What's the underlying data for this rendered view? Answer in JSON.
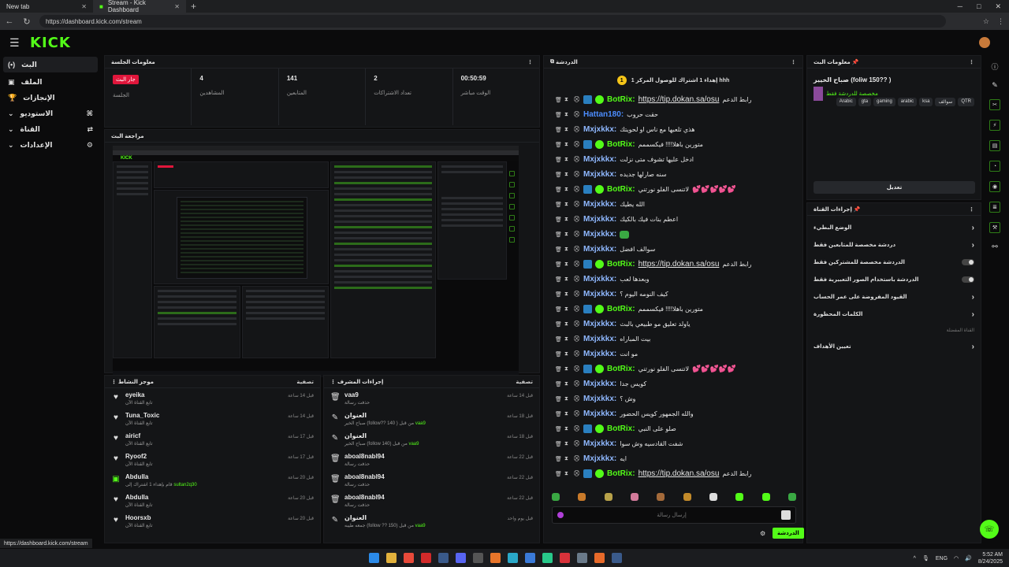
{
  "browser": {
    "tabs": [
      {
        "label": "New tab"
      },
      {
        "label": "Stream - Kick Dashboard"
      }
    ],
    "url": "https://dashboard.kick.com/stream",
    "status_url": "https://dashboard.kick.com/stream"
  },
  "app": {
    "logo": "KICK"
  },
  "leftnav": {
    "items": [
      {
        "label": "البث",
        "icon": "live-icon"
      },
      {
        "label": "الملف",
        "icon": "profile-icon"
      },
      {
        "label": "الإنجازات",
        "icon": "trophy-icon"
      },
      {
        "label": "الاستوديو",
        "icon": "studio-icon"
      },
      {
        "label": "القناة",
        "icon": "channel-icon"
      },
      {
        "label": "الإعدادات",
        "icon": "settings-icon"
      }
    ]
  },
  "session": {
    "title": "معلومات الجلسة",
    "stats": [
      {
        "value": "جار البث",
        "label": "الجلسة"
      },
      {
        "value": "4",
        "label": "المشاهدين"
      },
      {
        "value": "141",
        "label": "المتابعين"
      },
      {
        "value": "2",
        "label": "تعداد الاشتراكات"
      },
      {
        "value": "00:50:59",
        "label": "الوقت مباشر"
      }
    ]
  },
  "preview": {
    "title": "مراجعة البث",
    "logo": "KICK"
  },
  "activity": {
    "title": "موجز النشاط",
    "filter": "تصفية",
    "rows": [
      {
        "name": "eyeika",
        "sub": "تابع القناة الآن",
        "time": "قبل 14 ساعة",
        "icon": "heart-icon"
      },
      {
        "name": "Tuna_Toxic",
        "sub": "تابع القناة الآن",
        "time": "قبل 14 ساعة",
        "icon": "heart-icon"
      },
      {
        "name": "airicf",
        "sub": "تابع القناة الآن",
        "time": "قبل 17 ساعة",
        "icon": "heart-icon"
      },
      {
        "name": "Ryoof2",
        "sub": "تابع القناة الآن",
        "time": "قبل 17 ساعة",
        "icon": "heart-icon"
      },
      {
        "name": "Abdulla",
        "sub": "قام بإهداء 1 اشتراك إلى",
        "extra": "sultan2q30",
        "time": "قبل 20 ساعة",
        "icon": "gift-icon"
      },
      {
        "name": "Abdulla",
        "sub": "تابع القناة الآن",
        "time": "قبل 20 ساعة",
        "icon": "heart-icon"
      },
      {
        "name": "Hoorsxb",
        "sub": "تابع القناة الآن",
        "time": "قبل 20 ساعة",
        "icon": "heart-icon"
      }
    ]
  },
  "modactions": {
    "title": "إجراءات المشرف",
    "filter": "تصفية",
    "rows": [
      {
        "name": "vaa9",
        "sub": "حذفت رسالة",
        "time": "قبل 14 ساعة",
        "icon": "trash-icon"
      },
      {
        "name": "العنوان",
        "sub": "صباح الخير (follow?? 140 ) من قبل ",
        "user": "vaa9",
        "time": "قبل 18 ساعة",
        "icon": "edit-icon"
      },
      {
        "name": "العنوان",
        "sub": "صباح الخير (follow 140) من قبل ",
        "user": "vaa9",
        "time": "قبل 18 ساعة",
        "icon": "edit-icon"
      },
      {
        "name": "aboal8nabl94",
        "sub": "حذفت رسالة",
        "time": "قبل 22 ساعة",
        "icon": "trash-icon"
      },
      {
        "name": "aboal8nabl94",
        "sub": "حذفت رسالة",
        "time": "قبل 22 ساعة",
        "icon": "trash-icon"
      },
      {
        "name": "aboal8nabl94",
        "sub": "حذفت رسالة",
        "time": "قبل 22 ساعة",
        "icon": "trash-icon"
      },
      {
        "name": "العنوان",
        "sub": "جمعه طيبه (follow ?? 150) من قبل ",
        "user": "vaa9",
        "time": "قبل يوم واحد",
        "icon": "edit-icon"
      }
    ]
  },
  "chat": {
    "title": "الدردشة",
    "pinned_num": "1",
    "pinned": "إهداء 1 اشتراك للوصول المركز 1 hhh",
    "lines": [
      {
        "user": "BotRix",
        "bot": true,
        "text": "رابط الدعم",
        "link": "https://tip.dokan.sa/osu"
      },
      {
        "user": "Hattan180",
        "color": "#4c8dff",
        "text": "حقت حروب"
      },
      {
        "user": "Mxjxkkx",
        "text": "هذي تلعبها مع ناس او لحويتك"
      },
      {
        "user": "BotRix",
        "bot": true,
        "text": "متورين باهلا!!!! فيكسممم"
      },
      {
        "user": "Mxjxkkx",
        "text": "ادخل عليها تشوف متى نزلت"
      },
      {
        "user": "Mxjxkkx",
        "text": "سنه صارلها جديده"
      },
      {
        "user": "BotRix",
        "bot": true,
        "text": "لاتنسى الفلو نورتني",
        "hearts": "💕💕💕💕💕"
      },
      {
        "user": "Mxjxkkx",
        "text": "الله يطيك"
      },
      {
        "user": "Mxjxkkx",
        "text": "اعطم بنات فيك بالكيك"
      },
      {
        "user": "Mxjxkkx",
        "emote": true
      },
      {
        "user": "Mxjxkkx",
        "text": "سوالف افضل"
      },
      {
        "user": "BotRix",
        "bot": true,
        "text": "رابط الدعم",
        "link": "https://tip.dokan.sa/osu"
      },
      {
        "user": "Mxjxkkx",
        "text": "وبعدها لعب"
      },
      {
        "user": "Mxjxkkx",
        "text": "كيف النومه اليوم ؟"
      },
      {
        "user": "BotRix",
        "bot": true,
        "text": "متورين باهلا!!!! فيكسممم"
      },
      {
        "user": "Mxjxkkx",
        "text": "ياولد تعليق مو طبيعي بالبث"
      },
      {
        "user": "Mxjxkkx",
        "text": "بيت المباراه"
      },
      {
        "user": "Mxjxkkx",
        "text": "مو انت"
      },
      {
        "user": "BotRix",
        "bot": true,
        "text": "لاتنسى الفلو نورتني",
        "hearts": "💕💕💕💕💕"
      },
      {
        "user": "Mxjxkkx",
        "text": "كويس جدا"
      },
      {
        "user": "Mxjxkkx",
        "text": "وش ؟"
      },
      {
        "user": "Mxjxkkx",
        "text": "والله الجمهور كويس الحضور"
      },
      {
        "user": "BotRix",
        "bot": true,
        "text": "صلو على النبي"
      },
      {
        "user": "Mxjxkkx",
        "text": "شفت القادسيه وش سوا"
      },
      {
        "user": "Mxjxkkx",
        "text": "ايه"
      },
      {
        "user": "BotRix",
        "bot": true,
        "text": "رابط الدعم",
        "link": "https://tip.dokan.sa/osu"
      }
    ],
    "input_placeholder": "إرسال رسالة",
    "send_label": "الدردشة"
  },
  "streaminfo": {
    "title": "معلومات البث",
    "stream_title": "صباح الخيير (foliw 150?? )",
    "category": "مخصصة للدردشة فقط",
    "tags": [
      "QTR",
      "سوالف",
      "ksa",
      "arabic",
      "gaming",
      "gta",
      "Arabic"
    ],
    "edit": "تعديل"
  },
  "channelactions": {
    "title": "إجراءات القناة",
    "rows": [
      {
        "label": "الوضع البطيء",
        "type": "chevron"
      },
      {
        "label": "دردشة مخصصة للمتابعين فقط",
        "type": "chevron"
      },
      {
        "label": "الدردشة مخصصة للمشتركين فقط",
        "type": "toggle"
      },
      {
        "label": "الدردشة باستخدام الصور التعبيرية فقط",
        "type": "toggle"
      },
      {
        "label": "القيود المفروضة على عمر الحساب",
        "type": "chevron"
      },
      {
        "label": "الكلمات المحظورة",
        "type": "chevron"
      }
    ],
    "section_label": "القناة المفضلة",
    "goals": "تعيين الأهداف"
  },
  "taskbar": {
    "lang": "ENG",
    "time": "5:52 AM",
    "date": "8/24/2025"
  },
  "colors": {
    "accent": "#53fc18",
    "bg": "#0b0b0c",
    "panel": "#141517",
    "live": "#e0163b"
  }
}
